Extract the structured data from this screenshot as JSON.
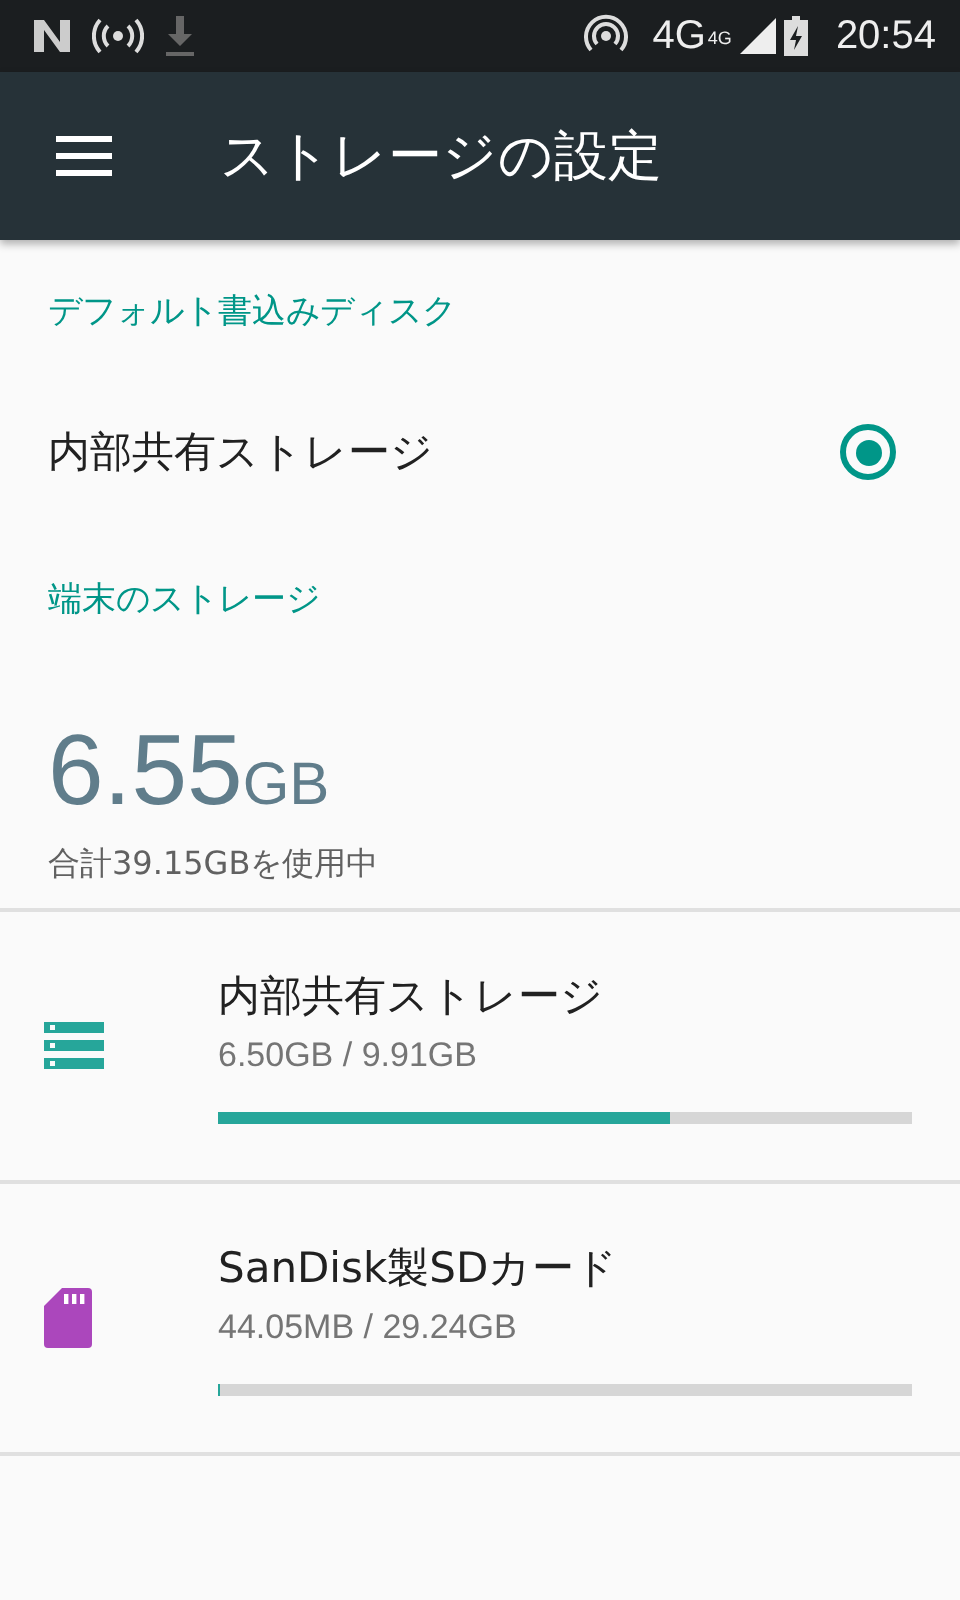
{
  "status_bar": {
    "network": "4G",
    "network_small": "4G",
    "time": "20:54"
  },
  "toolbar": {
    "title": "ストレージの設定"
  },
  "default_disk": {
    "header": "デフォルト書込みディスク",
    "options": [
      {
        "label": "内部共有ストレージ",
        "selected": true
      }
    ]
  },
  "device_storage": {
    "header": "端末のストレージ",
    "used_amount": "6.55",
    "used_unit": "GB",
    "total": "合計39.15GBを使用中",
    "items": [
      {
        "kind": "internal",
        "color": "#26a69a",
        "name": "内部共有ストレージ",
        "usage": "6.50GB / 9.91GB",
        "level": 0.65
      },
      {
        "kind": "sd",
        "color": "#ab47bc",
        "name": "SanDisk製SDカード",
        "usage": "44.05MB / 29.24GB",
        "level": 0.002
      }
    ]
  }
}
